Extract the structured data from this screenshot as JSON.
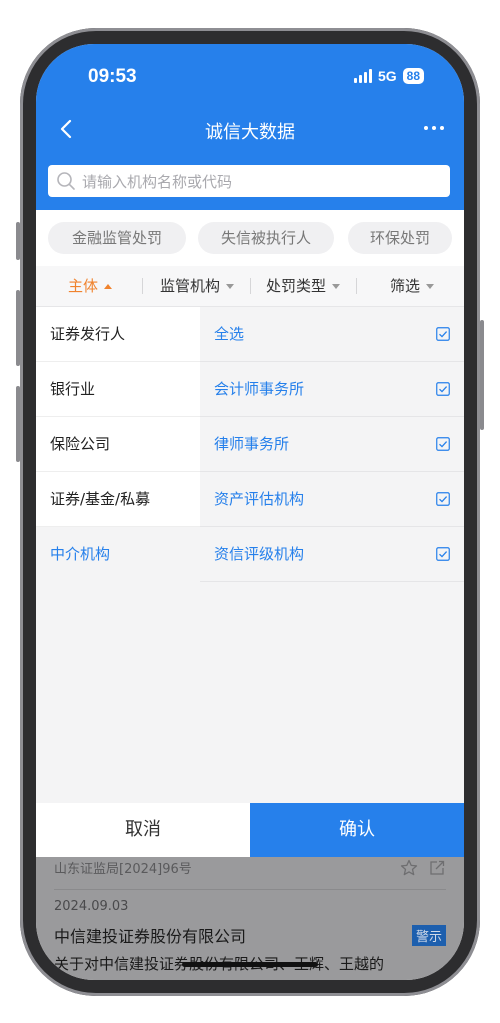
{
  "status": {
    "time": "09:53",
    "network": "5G",
    "battery": "88"
  },
  "nav": {
    "title": "诚信大数据",
    "back_icon": "chevron-left-icon",
    "more_icon": "more-horizontal-icon"
  },
  "search": {
    "placeholder": "请输入机构名称或代码"
  },
  "chips": [
    "金融监管处罚",
    "失信被执行人",
    "环保处罚"
  ],
  "filter_tabs": [
    {
      "label": "主体",
      "active": true
    },
    {
      "label": "监管机构",
      "active": false
    },
    {
      "label": "处罚类型",
      "active": false
    },
    {
      "label": "筛选",
      "active": false
    }
  ],
  "categories": [
    "证券发行人",
    "银行业",
    "保险公司",
    "证券/基金/私募",
    "中介机构"
  ],
  "selected_category": "中介机构",
  "options": [
    {
      "label": "全选",
      "checked": true
    },
    {
      "label": "会计师事务所",
      "checked": true
    },
    {
      "label": "律师事务所",
      "checked": true
    },
    {
      "label": "资产评估机构",
      "checked": true
    },
    {
      "label": "资信评级机构",
      "checked": true
    }
  ],
  "actions": {
    "cancel": "取消",
    "confirm": "确认"
  },
  "record": {
    "ref": "山东证监局[2024]96号",
    "date": "2024.09.03",
    "company": "中信建投证券股份有限公司",
    "badge": "警示",
    "summary": "关于对中信建投证券股份有限公司、王辉、王越的"
  },
  "colors": {
    "primary": "#2680eb",
    "accent": "#f0832e"
  }
}
